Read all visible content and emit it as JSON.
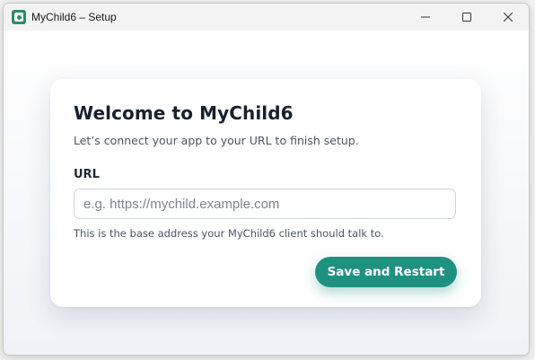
{
  "window": {
    "title": "MyChild6 – Setup"
  },
  "card": {
    "heading": "Welcome to MyChild6",
    "subtitle": "Let’s connect your app to your URL to finish setup.",
    "url_label": "URL",
    "url_value": "",
    "url_placeholder": "e.g. https://mychild.example.com",
    "helper_text": "This is the base address your MyChild6 client should talk to.",
    "save_button_label": "Save and Restart"
  },
  "colors": {
    "accent": "#1f9180",
    "heading": "#16202e",
    "app_icon": "#2e8b6e"
  },
  "icons": {
    "app": "app-logo-icon",
    "minimize": "minimize-icon",
    "maximize": "maximize-icon",
    "close": "close-icon"
  }
}
